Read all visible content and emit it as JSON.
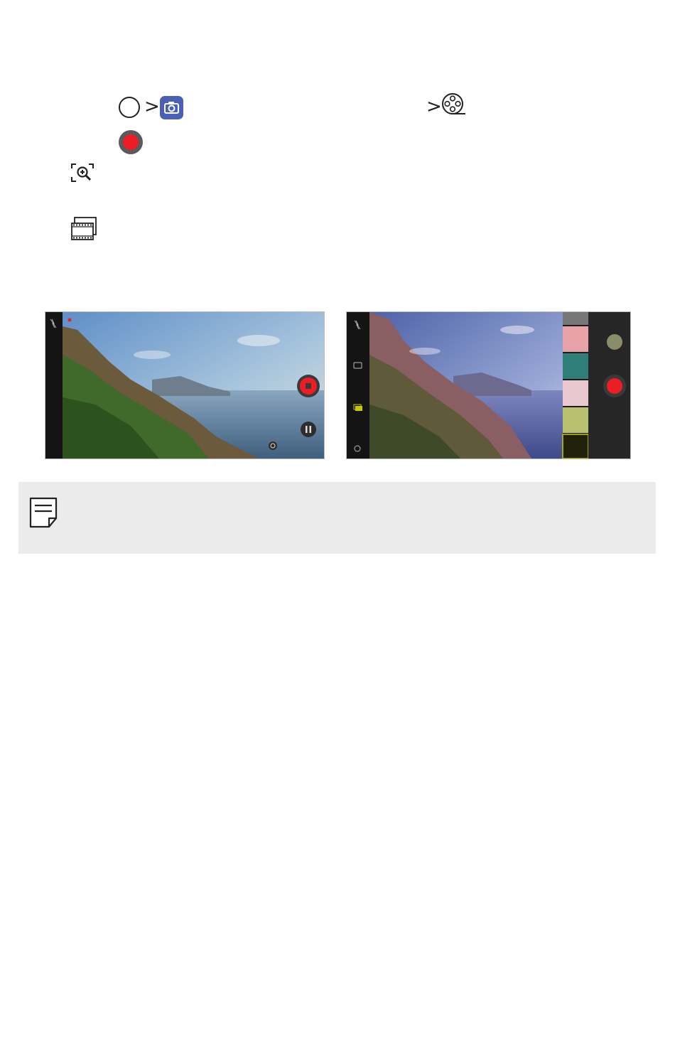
{
  "page": {
    "background": "#ffffff",
    "note_background": "#ebebeb"
  },
  "step1": {
    "home_icon": "home-circle-icon",
    "separator_1": ">",
    "camera_icon": "camera-app-icon",
    "separator_2": ">",
    "video_mode_icon": "film-reel-icon"
  },
  "step2": {
    "record_icon": "record-button-icon",
    "record_color": "#ee1c24"
  },
  "feature_icons": [
    {
      "icon": "zoom-frame-icon"
    },
    {
      "icon": "frame-grab-icon"
    }
  ],
  "screenshots": {
    "left": {
      "description_icons": [
        "flash-off-icon",
        "stop-record-button-icon",
        "pause-icon",
        "switch-camera-icon"
      ],
      "record_color": "#ee1c24"
    },
    "right": {
      "description_icons": [
        "flash-off-icon",
        "switch-camera-icon",
        "gallery-icon",
        "settings-icon",
        "record-button-icon"
      ],
      "record_color": "#ee1c24"
    }
  },
  "note": {
    "icon": "note-icon"
  }
}
